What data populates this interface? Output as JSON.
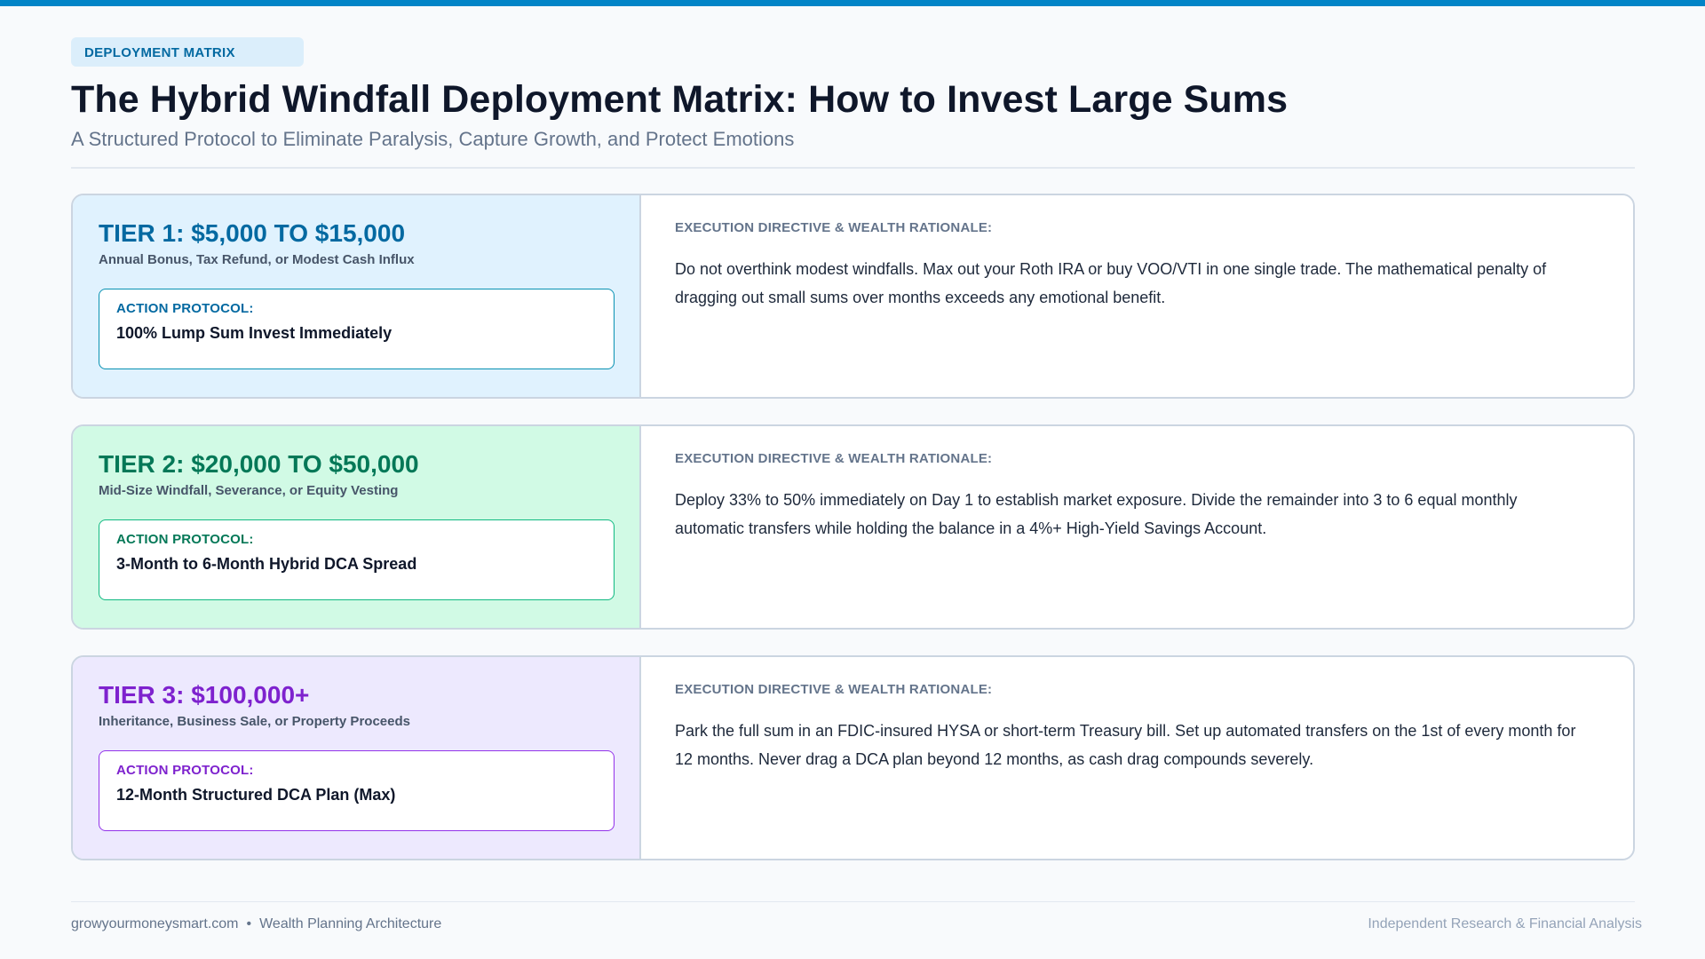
{
  "header": {
    "tag": "DEPLOYMENT MATRIX",
    "title": "The Hybrid Windfall Deployment Matrix: How to Invest Large Sums",
    "subtitle": "A Structured Protocol to Eliminate Paralysis, Capture Growth, and Protect Emotions"
  },
  "tiers": [
    {
      "title": "TIER 1: $5,000 TO $15,000",
      "subtitle": "Annual Bonus, Tax Refund, or Modest Cash Influx",
      "action_label": "ACTION PROTOCOL:",
      "action_value": "100% Lump Sum Invest Immediately",
      "directive_label": "EXECUTION DIRECTIVE & WEALTH RATIONALE:",
      "directive_text": "Do not overthink modest windfalls. Max out your Roth IRA or buy VOO/VTI in one single trade. The mathematical penalty of dragging out small sums over months exceeds any emotional benefit.",
      "accent": "#0369a1"
    },
    {
      "title": "TIER 2: $20,000 TO $50,000",
      "subtitle": "Mid-Size Windfall, Severance, or Equity Vesting",
      "action_label": "ACTION PROTOCOL:",
      "action_value": "3-Month to 6-Month Hybrid DCA Spread",
      "directive_label": "EXECUTION DIRECTIVE & WEALTH RATIONALE:",
      "directive_text": "Deploy 33% to 50% immediately on Day 1 to establish market exposure. Divide the remainder into 3 to 6 equal monthly automatic transfers while holding the balance in a 4%+ High-Yield Savings Account.",
      "accent": "#047857"
    },
    {
      "title": "TIER 3: $100,000+",
      "subtitle": "Inheritance, Business Sale, or Property Proceeds",
      "action_label": "ACTION PROTOCOL:",
      "action_value": "12-Month Structured DCA Plan (Max)",
      "directive_label": "EXECUTION DIRECTIVE & WEALTH RATIONALE:",
      "directive_text": "Park the full sum in an FDIC-insured HYSA or short-term Treasury bill. Set up automated transfers on the 1st of every month for 12 months. Never drag a DCA plan beyond 12 months, as cash drag compounds severely.",
      "accent": "#7e22ce"
    }
  ],
  "footer": {
    "site": "growyourmoneysmart.com",
    "separator": "•",
    "section": "Wealth Planning Architecture",
    "right": "Independent Research & Financial Analysis"
  },
  "colors": {
    "top_bar": "#0284c7",
    "background": "#f8fafc"
  }
}
